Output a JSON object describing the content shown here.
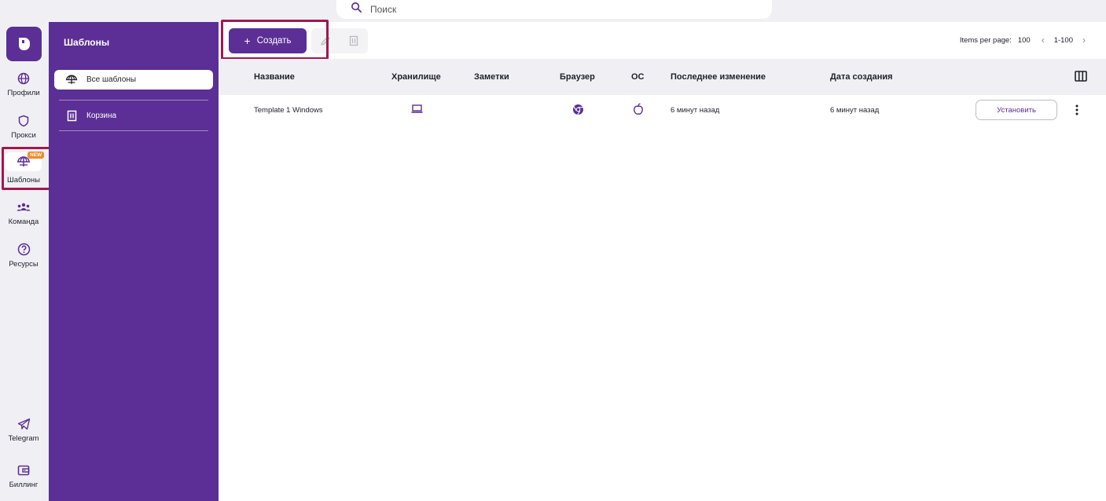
{
  "search": {
    "placeholder": "Поиск"
  },
  "rail": {
    "items": [
      {
        "label": "Профили",
        "icon": "globe-icon"
      },
      {
        "label": "Прокси",
        "icon": "shield-icon"
      },
      {
        "label": "Шаблоны",
        "icon": "template-icon",
        "badge": "NEW",
        "active": true
      },
      {
        "label": "Команда",
        "icon": "team-icon"
      },
      {
        "label": "Ресурсы",
        "icon": "help-icon"
      },
      {
        "label": "Telegram",
        "icon": "telegram-icon"
      },
      {
        "label": "Биллинг",
        "icon": "wallet-icon"
      }
    ]
  },
  "sidebar": {
    "title": "Шаблоны",
    "items": [
      {
        "label": "Все шаблоны",
        "icon": "template-icon",
        "active": true
      },
      {
        "label": "Корзина",
        "icon": "trash-icon"
      }
    ]
  },
  "toolbar": {
    "create_label": "Создать",
    "pager": {
      "items_per_page_label": "Items per page:",
      "items_per_page": "100",
      "range": "1-100"
    }
  },
  "table": {
    "columns": [
      "Название",
      "Хранилище",
      "Заметки",
      "Браузер",
      "ОС",
      "Последнее изменение",
      "Дата создания"
    ],
    "rows": [
      {
        "name": "Template 1 Windows",
        "storage_icon": "laptop-icon",
        "notes": "",
        "browser_icon": "chromium-icon",
        "os_icon": "apple-icon",
        "modified": "6 минут назад",
        "created": "6 минут назад",
        "action_label": "Установить"
      }
    ]
  },
  "colors": {
    "brand": "#5b2f95",
    "highlight": "#a3174e",
    "badge": "#f08a24"
  }
}
